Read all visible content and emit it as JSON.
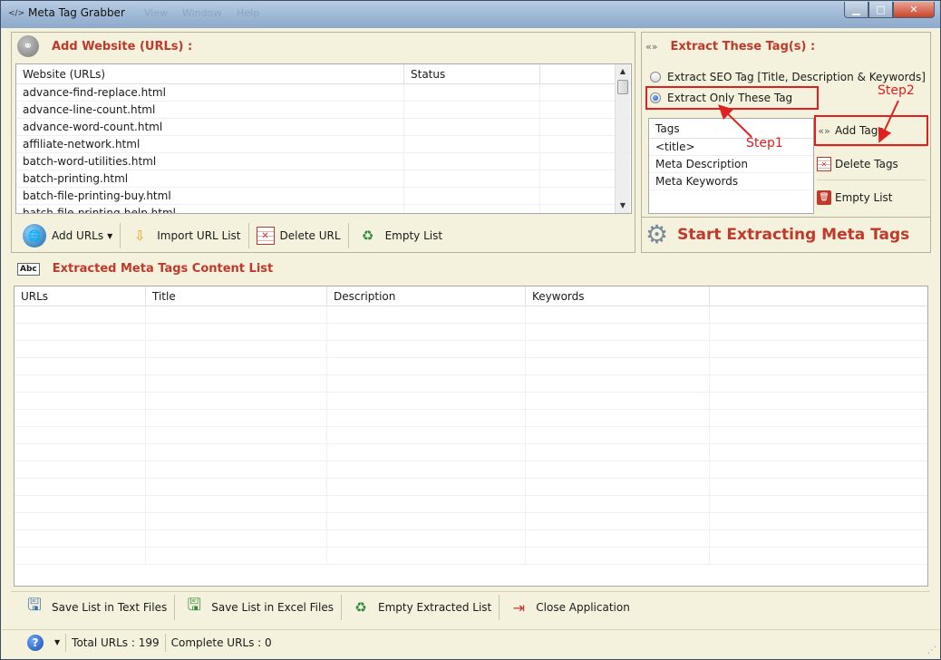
{
  "window": {
    "title": "Meta Tag Grabber",
    "menu_ghost": [
      "View",
      "Window",
      "Help"
    ],
    "controls": {
      "minimize": "▁",
      "maximize": "□",
      "close": "✕"
    }
  },
  "add_website": {
    "title": "Add Website (URLs) :",
    "icon": "link-icon",
    "columns": [
      "Website (URLs)",
      "Status",
      ""
    ],
    "rows": [
      [
        "advance-find-replace.html",
        "",
        ""
      ],
      [
        "advance-line-count.html",
        "",
        ""
      ],
      [
        "advance-word-count.html",
        "",
        ""
      ],
      [
        "affiliate-network.html",
        "",
        ""
      ],
      [
        "batch-word-utilities.html",
        "",
        ""
      ],
      [
        "batch-printing.html",
        "",
        ""
      ],
      [
        "batch-file-printing-buy.html",
        "",
        ""
      ],
      [
        "batch-file-printing-help.html",
        "",
        ""
      ]
    ],
    "toolbar": {
      "add_urls": "Add URLs",
      "import_url_list": "Import URL List",
      "delete_url": "Delete URL",
      "empty_list": "Empty List"
    }
  },
  "extract_tags": {
    "title": "Extract These Tag(s) :",
    "icon": "double-arrow-icon",
    "option_seo": "Extract SEO Tag [Title, Description & Keywords]",
    "option_only": "Extract Only These Tag",
    "selected": "option_only",
    "tags_header": "Tags",
    "tags": [
      "<title>",
      "Meta Description",
      "Meta Keywords"
    ],
    "add_tags": "Add Tags",
    "delete_tags": "Delete Tags",
    "empty_list": "Empty List",
    "start_button": "Start Extracting Meta Tags"
  },
  "annotations": {
    "step1": "Step1",
    "step2": "Step2"
  },
  "extracted": {
    "title": "Extracted Meta Tags Content List",
    "icon_text": "Abc",
    "columns": [
      "URLs",
      "Title",
      "Description",
      "Keywords",
      ""
    ],
    "row_count": 15,
    "toolbar": {
      "save_text": "Save List in Text Files",
      "save_excel": "Save List in Excel Files",
      "empty_extracted": "Empty Extracted List",
      "close_app": "Close Application"
    }
  },
  "status": {
    "total_urls": "Total URLs :  199",
    "complete_urls": "Complete URLs :  0"
  },
  "colors": {
    "accent_red": "#c0392b",
    "annotation": "#e02020",
    "panel_bg": "#f4f1dc"
  }
}
